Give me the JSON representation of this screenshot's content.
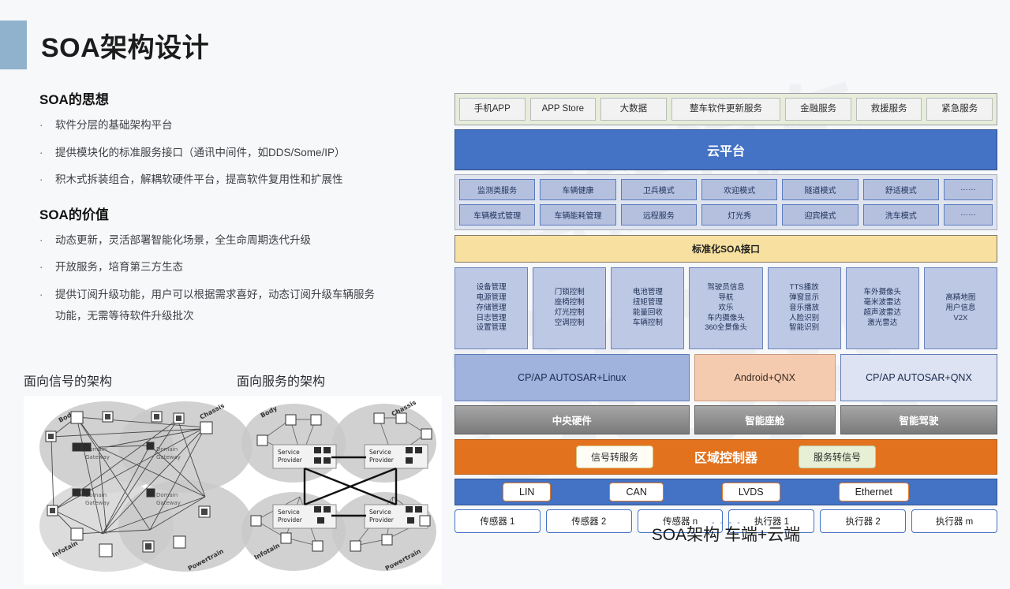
{
  "header": {
    "title": "SOA架构设计"
  },
  "left": {
    "section1_title": "SOA的思想",
    "section1_bullets": [
      "软件分层的基础架构平台",
      "提供模块化的标准服务接口（通讯中间件，如DDS/Some/IP）",
      "积木式拆装组合，解耦软硬件平台，提高软件复用性和扩展性"
    ],
    "section2_title": "SOA的价值",
    "section2_bullets": [
      "动态更新，灵活部署智能化场景，全生命周期迭代升级",
      "开放服务，培育第三方生态",
      "提供订阅升级功能，用户可以根据需求喜好，动态订阅升级车辆服务"
    ],
    "section2_continuation": "功能，无需等待软件升级批次",
    "bullet_marker": "·"
  },
  "diagrams": {
    "left_title": "面向信号的架构",
    "right_title": "面向服务的架构",
    "domains": [
      "Body",
      "Chassis",
      "Infotain",
      "Powertrain"
    ],
    "left_node_label": "Domain Gateway",
    "right_node_label": "Service Provider"
  },
  "arch": {
    "apps": [
      "手机APP",
      "APP Store",
      "大数据",
      "整车软件更新服务",
      "金融服务",
      "救援服务",
      "紧急服务"
    ],
    "cloud_platform": "云平台",
    "services_row1": [
      "监测类服务",
      "车辆健康",
      "卫兵模式",
      "欢迎模式",
      "隧道模式",
      "舒适模式",
      "……"
    ],
    "services_row2": [
      "车辆模式管理",
      "车辆能耗管理",
      "远程服务",
      "灯光秀",
      "迎宾模式",
      "洗车模式",
      "……"
    ],
    "soa_interface": "标准化SOA接口",
    "components": [
      [
        "设备管理",
        "电源管理",
        "存储管理",
        "日志管理",
        "设置管理"
      ],
      [
        "门锁控制",
        "座椅控制",
        "灯光控制",
        "空调控制"
      ],
      [
        "电池管理",
        "扭矩管理",
        "能量回收",
        "车辆控制"
      ],
      [
        "驾驶员信息",
        "导航",
        "欢乐",
        "车内摄像头",
        "360全景像头"
      ],
      [
        "TTS播放",
        "弹窗显示",
        "音乐播放",
        "人脸识别",
        "智能识别"
      ],
      [
        "车外摄像头",
        "毫米波雷达",
        "超声波雷达",
        "激光雷达"
      ],
      [
        "高精地图",
        "用户信息",
        "V2X"
      ]
    ],
    "os_layers": [
      {
        "os": "CP/AP AUTOSAR+Linux",
        "hw": "中央硬件"
      },
      {
        "os": "Android+QNX",
        "hw": "智能座舱"
      },
      {
        "os": "CP/AP AUTOSAR+QNX",
        "hw": "智能驾驶"
      }
    ],
    "zone": {
      "left_pill": "信号转服务",
      "title": "区域控制器",
      "right_pill": "服务转信号"
    },
    "buses": [
      "LIN",
      "CAN",
      "LVDS",
      "Ethernet"
    ],
    "nodes": [
      "传感器 1",
      "传感器 2",
      "传感器 n",
      "执行器 1",
      "执行器 2",
      "执行器 m"
    ],
    "node_dashes": "- - - -",
    "caption": "SOA架构 车端+云端"
  },
  "colors": {
    "accent_bar": "#90b2cd",
    "cloud_blue": "#4472c4",
    "soa_yellow": "#f7e0a0",
    "zone_orange": "#e2721e",
    "cockpit_peach": "#f5cbb0",
    "apps_green": "#e7edd9"
  }
}
